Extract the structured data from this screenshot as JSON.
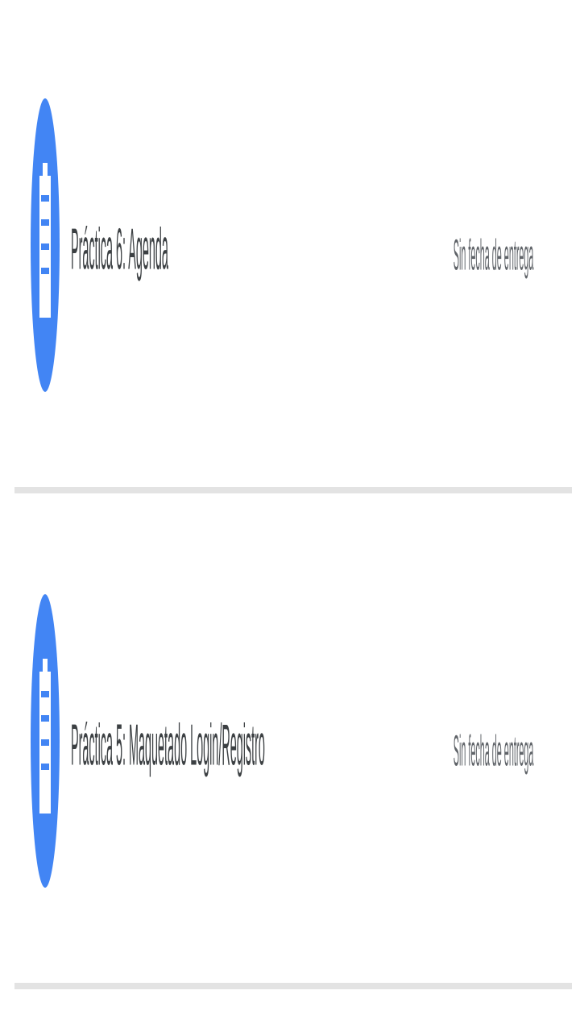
{
  "assignments": [
    {
      "icon": "assignment-icon",
      "title": "Práctica 6: Agenda",
      "due": "Sin fecha de entrega"
    },
    {
      "icon": "assignment-icon",
      "title": "Práctica 5: Maquetado Login/Registro",
      "due": "Sin fecha de entrega"
    }
  ],
  "colors": {
    "icon_bg": "#4285f4",
    "icon_fg": "#ffffff",
    "title_text": "#3c4043",
    "due_text": "#5f6368",
    "divider": "#e3e3e3"
  }
}
